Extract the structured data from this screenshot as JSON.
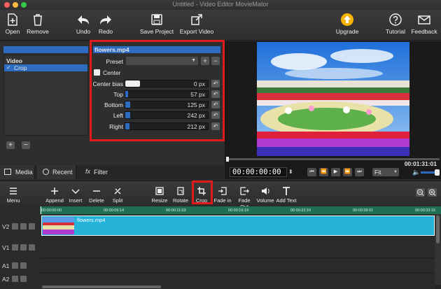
{
  "window": {
    "title": "Untitled - Video Editor MovieMator"
  },
  "toolbar": {
    "open": "Open",
    "remove": "Remove",
    "undo": "Undo",
    "redo": "Redo",
    "save_project": "Save Project",
    "export_video": "Export Video",
    "upgrade": "Upgrade",
    "tutorial": "Tutorial",
    "feedback": "Feedback"
  },
  "filter_list": {
    "group": "Video",
    "item": "Crop"
  },
  "filter_panel": {
    "clip_name": "flowers.mp4",
    "preset_label": "Preset",
    "center_label": "Center",
    "params": [
      {
        "label": "Center bias",
        "value": "0 px",
        "fraction": 0.18
      },
      {
        "label": "Top",
        "value": "57 px",
        "fraction": 0.03
      },
      {
        "label": "Bottom",
        "value": "125 px",
        "fraction": 0.06
      },
      {
        "label": "Left",
        "value": "242 px",
        "fraction": 0.06
      },
      {
        "label": "Right",
        "value": "212 px",
        "fraction": 0.05
      }
    ]
  },
  "tabs": {
    "media": "Media",
    "recent": "Recent",
    "filter": "Filter"
  },
  "player": {
    "current_time": "00:00:00:00",
    "duration": "00:01:31:01",
    "zoom": "Fit",
    "progress": 0.0
  },
  "timeline_toolbar": {
    "menu": "Menu",
    "append": "Append",
    "insert": "Insert",
    "delete": "Delete",
    "split": "Split",
    "resize": "Resize",
    "rotate": "Rotate",
    "crop": "Crop",
    "fade_in": "Fade in",
    "fade_out": "Fade Out",
    "volume": "Volume",
    "add_text": "Add Text"
  },
  "ruler": {
    "ticks": [
      "00:00:00:00",
      "00:00:05:14",
      "00:00:11:03",
      "00:00:16:19",
      "00:00:22:10",
      "00:00:28:01",
      "00:00:33:16"
    ]
  },
  "tracks": {
    "v2": "V2",
    "v1": "V1",
    "a1": "A1",
    "a2": "A2"
  },
  "clip": {
    "name": "flowers.mp4"
  },
  "colors": {
    "accent": "#2d6cc0",
    "highlight_box": "#e11b1b",
    "clip": "#26b3d9",
    "ruler": "#1f6f52"
  }
}
